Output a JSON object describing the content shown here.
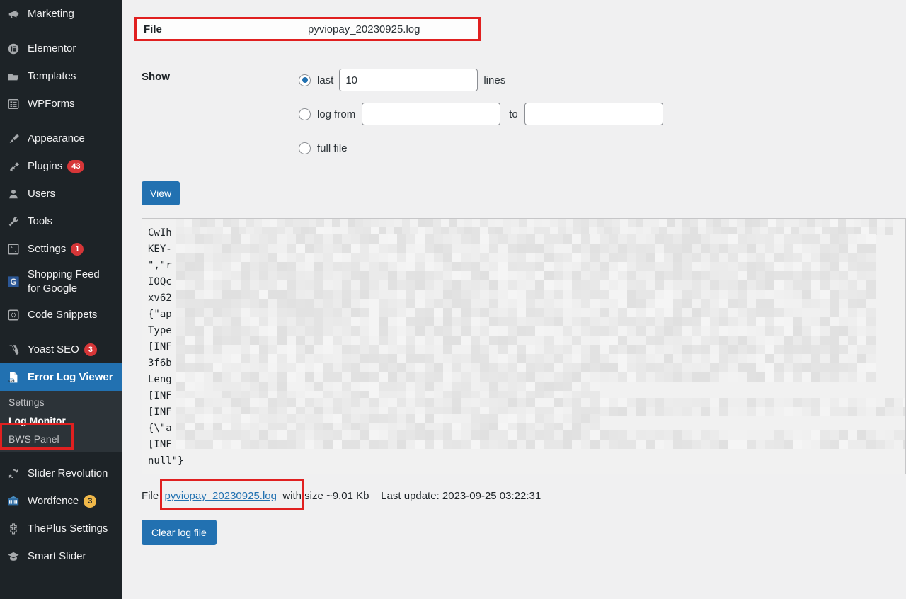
{
  "sidebar": {
    "items": [
      {
        "label": "Marketing",
        "icon": "megaphone-icon",
        "badge": null,
        "current": false,
        "gap_before": false
      },
      {
        "label": "Elementor",
        "icon": "elementor-icon",
        "badge": null,
        "current": false,
        "gap_before": true
      },
      {
        "label": "Templates",
        "icon": "folder-icon",
        "badge": null,
        "current": false,
        "gap_before": false
      },
      {
        "label": "WPForms",
        "icon": "wpforms-icon",
        "badge": null,
        "current": false,
        "gap_before": false
      },
      {
        "label": "Appearance",
        "icon": "paintbrush-icon",
        "badge": null,
        "current": false,
        "gap_before": true
      },
      {
        "label": "Plugins",
        "icon": "plug-icon",
        "badge": "43",
        "current": false,
        "gap_before": false
      },
      {
        "label": "Users",
        "icon": "user-icon",
        "badge": null,
        "current": false,
        "gap_before": false
      },
      {
        "label": "Tools",
        "icon": "wrench-icon",
        "badge": null,
        "current": false,
        "gap_before": false
      },
      {
        "label": "Settings",
        "icon": "sliders-icon",
        "badge": "1",
        "current": false,
        "gap_before": false
      },
      {
        "label": "Shopping Feed for Google",
        "icon": "google-icon",
        "badge": null,
        "current": false,
        "gap_before": false
      },
      {
        "label": "Code Snippets",
        "icon": "code-icon",
        "badge": null,
        "current": false,
        "gap_before": false
      },
      {
        "label": "Yoast SEO",
        "icon": "yoast-icon",
        "badge": "3",
        "current": false,
        "gap_before": true
      },
      {
        "label": "Error Log Viewer",
        "icon": "log-document-icon",
        "badge": null,
        "current": true,
        "gap_before": false
      }
    ],
    "submenu": [
      {
        "label": "Settings",
        "current": false
      },
      {
        "label": "Log Monitor",
        "current": true
      },
      {
        "label": "BWS Panel",
        "current": false
      }
    ],
    "items_after": [
      {
        "label": "Slider Revolution",
        "icon": "refresh-icon",
        "badge": null,
        "badge_color": null
      },
      {
        "label": "Wordfence",
        "icon": "wordfence-icon",
        "badge": "3",
        "badge_color": "orange"
      },
      {
        "label": "ThePlus Settings",
        "icon": "theplus-icon",
        "badge": null,
        "badge_color": null
      },
      {
        "label": "Smart Slider",
        "icon": "graduation-cap-icon",
        "badge": null,
        "badge_color": null
      }
    ]
  },
  "form": {
    "file_label": "File",
    "file_value": "pyviopay_20230925.log",
    "show_label": "Show",
    "option_last": "last",
    "lines_value": "10",
    "lines_suffix": "lines",
    "option_log_from": "log from",
    "from_value": "",
    "from_placeholder": "",
    "to_word": "to",
    "to_value": "",
    "to_placeholder": "",
    "option_full_file": "full file",
    "view_button": "View",
    "selected_option": "last"
  },
  "log": {
    "lines": [
      {
        "left": "CwIh",
        "right": "ug4pAp"
      },
      {
        "left": "KEY-",
        "right": ""
      },
      {
        "left": "\",\"r",
        "right": "JoZd2w"
      },
      {
        "left": "IOQc",
        "right": "u\\/hS+"
      },
      {
        "left": "xv62",
        "right": "/api.p"
      },
      {
        "left": "{\"ap",
        "right": "ials\","
      },
      {
        "left": "Type",
        "right": "-Platf"
      },
      {
        "left": "[INF",
        "right": "e: ap"
      },
      {
        "left": "3f6b",
        "right": "wH60X2"
      },
      {
        "left": "Leng",
        "right": ""
      },
      {
        "left": "[INF",
        "right": ""
      },
      {
        "left": "[INF",
        "right": ""
      },
      {
        "left": "{\\\"a",
        "right": "ent_cr"
      },
      {
        "left": "[INF",
        "right": "validE"
      },
      {
        "left": "null\"}",
        "right": ""
      }
    ]
  },
  "footer": {
    "file_word": "File",
    "file_link": "pyviopay_20230925.log",
    "size_text": "with size ~9.01 Kb",
    "last_update_text": "Last update: 2023-09-25 03:22:31",
    "clear_button": "Clear log file"
  },
  "colors": {
    "accent": "#2271b1",
    "sidebar_bg": "#1d2327",
    "submenu_bg": "#2c3338",
    "highlight_red": "#e02020",
    "badge_red": "#d63638",
    "badge_orange": "#f0b849"
  }
}
